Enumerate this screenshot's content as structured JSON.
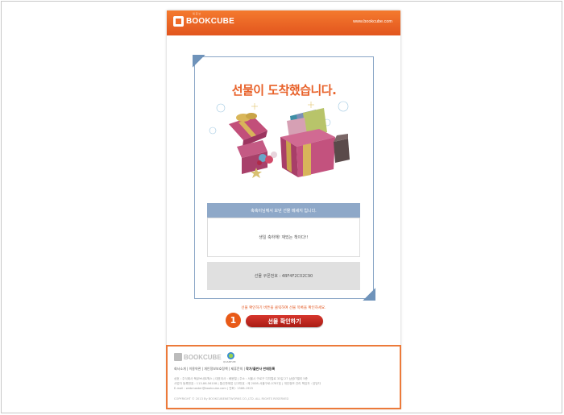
{
  "header": {
    "logo_text": "BOOKCUBE",
    "logo_sub": "북 큐 브",
    "site_url": "www.bookcube.com"
  },
  "card": {
    "headline": "선물이 도착했습니다.",
    "sender_text": "축축이님께서 보낸 선물 메세지 입니다.",
    "message": "생일 축하해! 재밌는 책이다!!",
    "coupon_label": "선물 쿠폰번호 : 4BF4F2C02C90"
  },
  "action": {
    "notice": "선물 확인하기 버튼을 클릭하여 선물 목록을 확인하세요.",
    "step": "1",
    "button_label": "선물 확인하기"
  },
  "footer": {
    "logo_text": "BOOKCUBE",
    "partner_text": "QUANTUM",
    "links": "회사소개 | 이용약관 | 개인정보보호정책 | 제휴문의 | ",
    "links_bold": "작가/출판사 판매등록",
    "address1": "상호 : 주식회사 북큐브네트웍스  |  대표이사 : 배응철  |  주소 : 서울시 구로구 디지털로 33길 27 삼성IT밸리 5층",
    "address2": "사업자 등록번호 : 113-86-56108  |  통신판매업 신고번호 : 제 2008-서울구로-0787호  |  개인정보 관리 책임자 : 담당자",
    "address3": "E-mail : webmaster@bookcube.com  |  전화 : 1588-1925",
    "copyright": "COPYRIGHT © 2013 By BOOKCUBENETWORKS CO.,LTD. ALL RIGHTS RESERVED"
  },
  "colors": {
    "brand_orange": "#f06a28",
    "card_blue": "#8ea8c8",
    "button_red": "#c0261d"
  }
}
